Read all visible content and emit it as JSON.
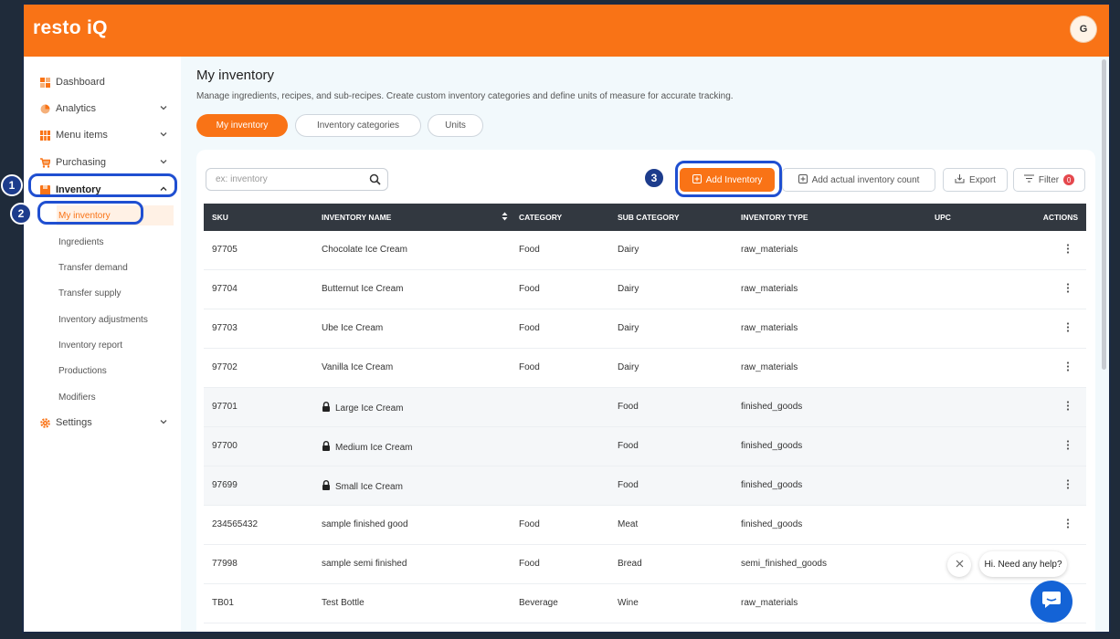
{
  "app": {
    "logo": "resto iQ",
    "avatar_initial": "G"
  },
  "sidebar": {
    "items": [
      {
        "label": "Dashboard",
        "icon": "dashboard-icon"
      },
      {
        "label": "Analytics",
        "icon": "pie-chart-icon"
      },
      {
        "label": "Menu items",
        "icon": "menu-grid-icon"
      },
      {
        "label": "Purchasing",
        "icon": "cart-icon"
      },
      {
        "label": "Inventory",
        "icon": "inventory-box-icon"
      },
      {
        "label": "Settings",
        "icon": "gear-icon"
      }
    ],
    "inventory_sub": [
      "My inventory",
      "Ingredients",
      "Transfer demand",
      "Transfer supply",
      "Inventory adjustments",
      "Inventory report",
      "Productions",
      "Modifiers"
    ]
  },
  "annotations": [
    "1",
    "2",
    "3"
  ],
  "page": {
    "title": "My inventory",
    "subtitle": "Manage ingredients, recipes, and sub-recipes. Create custom inventory categories and define units of measure for accurate tracking.",
    "tabs": [
      "My inventory",
      "Inventory categories",
      "Units"
    ]
  },
  "toolbar": {
    "search_placeholder": "ex: inventory",
    "add_inventory": "Add Inventory",
    "add_count": "Add actual inventory count",
    "export": "Export",
    "filter": "Filter",
    "filter_count": "0"
  },
  "table": {
    "headers": [
      "SKU",
      "INVENTORY NAME",
      "CATEGORY",
      "SUB CATEGORY",
      "INVENTORY TYPE",
      "UPC",
      "ACTIONS"
    ],
    "rows": [
      {
        "sku": "97705",
        "name": "Chocolate Ice Cream",
        "category": "Food",
        "sub": "Dairy",
        "type": "raw_materials",
        "locked": false
      },
      {
        "sku": "97704",
        "name": "Butternut Ice Cream",
        "category": "Food",
        "sub": "Dairy",
        "type": "raw_materials",
        "locked": false
      },
      {
        "sku": "97703",
        "name": "Ube Ice Cream",
        "category": "Food",
        "sub": "Dairy",
        "type": "raw_materials",
        "locked": false
      },
      {
        "sku": "97702",
        "name": "Vanilla Ice Cream",
        "category": "Food",
        "sub": "Dairy",
        "type": "raw_materials",
        "locked": false
      },
      {
        "sku": "97701",
        "name": "Large Ice Cream",
        "category": "",
        "sub": "Food",
        "type": "finished_goods",
        "locked": true
      },
      {
        "sku": "97700",
        "name": "Medium Ice Cream",
        "category": "",
        "sub": "Food",
        "type": "finished_goods",
        "locked": true
      },
      {
        "sku": "97699",
        "name": "Small Ice Cream",
        "category": "",
        "sub": "Food",
        "type": "finished_goods",
        "locked": true
      },
      {
        "sku": "234565432",
        "name": "sample finished good",
        "category": "Food",
        "sub": "Meat",
        "type": "finished_goods",
        "locked": false
      },
      {
        "sku": "77998",
        "name": "sample semi finished",
        "category": "Food",
        "sub": "Bread",
        "type": "semi_finished_goods",
        "locked": false
      },
      {
        "sku": "TB01",
        "name": "Test Bottle",
        "category": "Beverage",
        "sub": "Wine",
        "type": "raw_materials",
        "locked": false
      }
    ]
  },
  "chat": {
    "greeting": "Hi. Need any help?"
  },
  "colors": {
    "brand": "#f97316",
    "highlight": "#1f4fd1",
    "header": "#323840"
  }
}
